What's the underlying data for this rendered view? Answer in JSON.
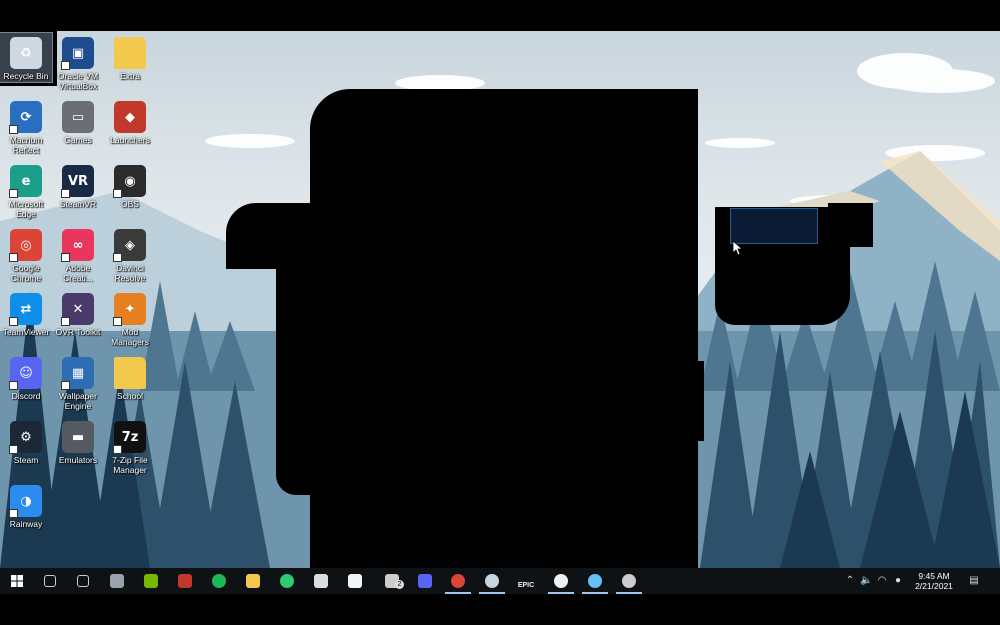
{
  "desktop": {
    "icons": [
      {
        "label": "Recycle Bin",
        "icon": "recycle-bin-icon",
        "color": "#cfd8e0"
      },
      {
        "label": "Oracle VM VirtualBox",
        "icon": "virtualbox-icon",
        "color": "#1f4c8f"
      },
      {
        "label": "Extra",
        "icon": "folder-icon",
        "color": "#f2c94c"
      },
      {
        "label": "Macrium Reflect",
        "icon": "macrium-reflect-icon",
        "color": "#2a6fbf"
      },
      {
        "label": "Games",
        "icon": "hard-drive-icon",
        "color": "#6b6f75"
      },
      {
        "label": "Launchers",
        "icon": "launchers-icon",
        "color": "#c0392b"
      },
      {
        "label": "Microsoft Edge",
        "icon": "edge-icon",
        "color": "#1b9e8a"
      },
      {
        "label": "SteamVR",
        "icon": "steamvr-icon",
        "color": "#1b2a44"
      },
      {
        "label": "OBS",
        "icon": "obs-icon",
        "color": "#2b2b2b"
      },
      {
        "label": "Google Chrome",
        "icon": "chrome-icon",
        "color": "#db4437"
      },
      {
        "label": "Adobe Creati...",
        "icon": "adobe-cc-icon",
        "color": "#e8365d"
      },
      {
        "label": "Davinci Resolve",
        "icon": "davinci-resolve-icon",
        "color": "#3a3a3a"
      },
      {
        "label": "TeamViewer",
        "icon": "teamviewer-icon",
        "color": "#0e8ee9"
      },
      {
        "label": "OVR Toolkit",
        "icon": "ovr-toolkit-icon",
        "color": "#4a3a6a"
      },
      {
        "label": "Mod Managers",
        "icon": "mod-managers-icon",
        "color": "#e67e22"
      },
      {
        "label": "Discord",
        "icon": "discord-icon",
        "color": "#5865f2"
      },
      {
        "label": "Wallpaper Engine",
        "icon": "wallpaper-engine-icon",
        "color": "#2e6db4"
      },
      {
        "label": "School",
        "icon": "folder-icon",
        "color": "#f2c94c"
      },
      {
        "label": "Steam",
        "icon": "steam-icon",
        "color": "#1b2838"
      },
      {
        "label": "Emulators",
        "icon": "emulators-icon",
        "color": "#555a60"
      },
      {
        "label": "7-Zip File Manager",
        "icon": "seven-zip-icon",
        "color": "#111111"
      },
      {
        "label": "Rainway",
        "icon": "rainway-icon",
        "color": "#2d8cf0"
      }
    ]
  },
  "taskbar": {
    "start_icon": "windows-start-icon",
    "items": [
      {
        "name": "search-icon",
        "color": "#cccccc"
      },
      {
        "name": "task-view-icon",
        "color": "#cccccc"
      },
      {
        "name": "app-hexagon-icon",
        "color": "#9aa3ad"
      },
      {
        "name": "nvidia-icon",
        "color": "#76b900"
      },
      {
        "name": "red-app-icon",
        "color": "#c0392b"
      },
      {
        "name": "spotify-icon",
        "color": "#1db954"
      },
      {
        "name": "file-explorer-icon",
        "color": "#f2c94c"
      },
      {
        "name": "green-plane-icon",
        "color": "#2ecc71"
      },
      {
        "name": "arrow-app-icon",
        "color": "#dddddd"
      },
      {
        "name": "store-icon",
        "color": "#f5f5f5"
      },
      {
        "name": "drive-app-icon",
        "color": "#cccccc"
      },
      {
        "name": "discord-icon",
        "color": "#5865f2"
      },
      {
        "name": "chrome-icon",
        "color": "#db4437"
      },
      {
        "name": "steam-icon",
        "color": "#c7d5e0"
      },
      {
        "name": "epic-games-icon",
        "color": "#eeeeee"
      },
      {
        "name": "xbox-icon",
        "color": "#f0f0f0"
      },
      {
        "name": "steam-icon",
        "color": "#66c0f4"
      },
      {
        "name": "obs-icon",
        "color": "#cccccc"
      }
    ],
    "badge": "2",
    "epic_label": "EPIC",
    "tray": {
      "time": "9:45 AM",
      "date": "2/21/2021"
    }
  }
}
